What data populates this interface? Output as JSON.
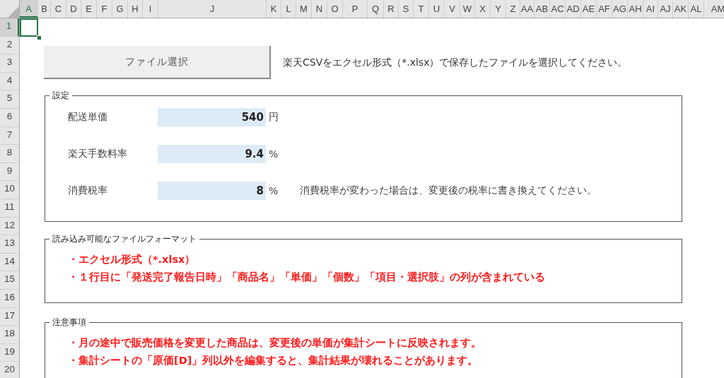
{
  "columns": [
    "A",
    "B",
    "C",
    "D",
    "E",
    "F",
    "G",
    "H",
    "I",
    "J",
    "K",
    "L",
    "M",
    "N",
    "O",
    "P",
    "Q",
    "R",
    "S",
    "T",
    "U",
    "V",
    "W",
    "X",
    "Y",
    "Z",
    "AA",
    "AB",
    "AC",
    "AD",
    "AE",
    "AF",
    "AG",
    "AH",
    "AI",
    "AJ",
    "AK",
    "AL",
    "AM"
  ],
  "rows": [
    "1",
    "2",
    "3",
    "4",
    "5",
    "6",
    "7",
    "8",
    "9",
    "10",
    "11",
    "12",
    "13",
    "14",
    "15",
    "16",
    "17",
    "18",
    "19",
    "20"
  ],
  "file_button": {
    "label": "ファイル選択"
  },
  "instruction": "楽天CSVをエクセル形式（*.xlsx）で保存したファイルを選択してください。",
  "settings": {
    "title": "設定",
    "fields": [
      {
        "label": "配送単価",
        "value": "540",
        "unit": "円"
      },
      {
        "label": "楽天手数料率",
        "value": "9.4",
        "unit": "%"
      },
      {
        "label": "消費税率",
        "value": "8",
        "unit": "%",
        "note": "消費税率が変わった場合は、変更後の税率に書き換えてください。"
      }
    ]
  },
  "file_format": {
    "title": "読み込み可能なファイルフォーマット",
    "items": [
      "・エクセル形式（*.xlsx）",
      "・１行目に「発送完了報告日時」「商品名」「単価」「個数」「項目・選択肢」の列が含まれている"
    ]
  },
  "cautions": {
    "title": "注意事項",
    "items": [
      "・月の途中で販売価格を変更した商品は、変更後の単価が集計シートに反映されます。",
      "・集計シートの「原価[D]」列以外を編集すると、集計結果が壊れることがあります。"
    ]
  }
}
